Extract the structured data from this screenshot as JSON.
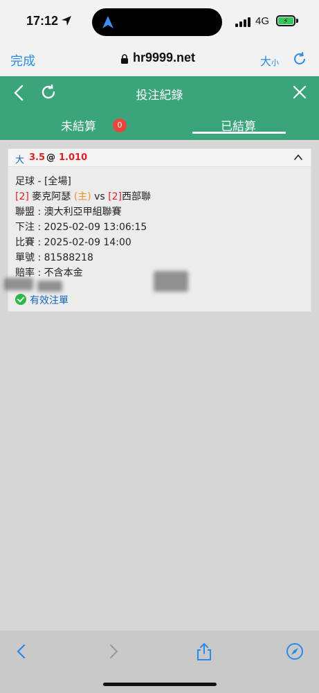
{
  "status_bar": {
    "time": "17:12",
    "network": "4G"
  },
  "browser": {
    "done_label": "完成",
    "url": "hr9999.net",
    "text_size_label": "大",
    "text_size_small": "小"
  },
  "header": {
    "title": "投注紀錄"
  },
  "tabs": [
    {
      "label": "未結算",
      "badge": "0"
    },
    {
      "label": "已結算"
    }
  ],
  "bet": {
    "type": "大",
    "line": "3.5",
    "at": "@",
    "odds": "1.010",
    "sport": "足球 - [全場]",
    "home_rank": "[2]",
    "home_team": "麥克阿瑟",
    "home_tag": "(主)",
    "vs": "vs",
    "away_rank": "[2]",
    "away_team": "西部聯",
    "league": "聯盟 : 澳大利亞甲組聯賽",
    "bet_time": "下注 : 2025-02-09 13:06:15",
    "match_time": "比賽 : 2025-02-09 14:00",
    "ticket_no": "單號 : 81588218",
    "odds_note": "賠率 : 不含本金",
    "status": "有效注單"
  },
  "colors": {
    "accent_green": "#3aa57a",
    "link_blue": "#2a8ae8",
    "badge_red": "#e8453c",
    "odds_red": "#e02020"
  }
}
